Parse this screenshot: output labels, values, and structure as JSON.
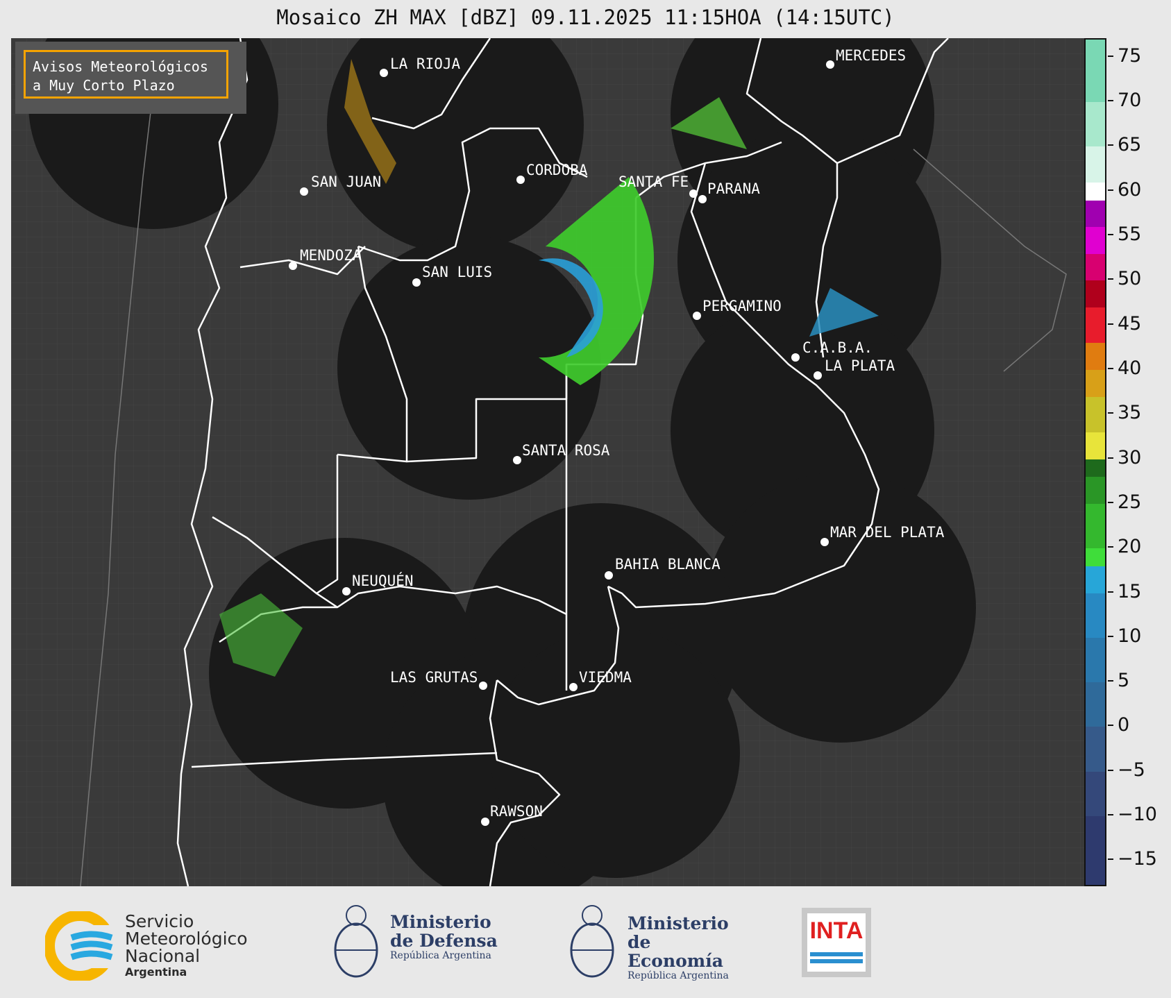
{
  "title": "Mosaico ZH MAX [dBZ] 09.11.2025 11:15HOA (14:15UTC)",
  "notice": {
    "line1": "Avisos Meteorológicos",
    "line2": "a Muy Corto Plazo"
  },
  "cities": [
    {
      "name": "LA RIOJA"
    },
    {
      "name": "MERCEDES"
    },
    {
      "name": "CORDOBA"
    },
    {
      "name": "SAN JUAN"
    },
    {
      "name": "SANTA FE"
    },
    {
      "name": "PARANA"
    },
    {
      "name": "MENDOZA"
    },
    {
      "name": "SAN LUIS"
    },
    {
      "name": "PERGAMINO"
    },
    {
      "name": "C.A.B.A."
    },
    {
      "name": "LA PLATA"
    },
    {
      "name": "SANTA ROSA"
    },
    {
      "name": "MAR DEL PLATA"
    },
    {
      "name": "BAHIA BLANCA"
    },
    {
      "name": "NEUQUÉN"
    },
    {
      "name": "LAS GRUTAS"
    },
    {
      "name": "VIEDMA"
    },
    {
      "name": "RAWSON"
    }
  ],
  "colorbar": {
    "min": -18,
    "max": 77,
    "ticks": [
      "75",
      "70",
      "65",
      "60",
      "55",
      "50",
      "45",
      "40",
      "35",
      "30",
      "25",
      "20",
      "15",
      "10",
      "5",
      "0",
      "−5",
      "−10",
      "−15"
    ],
    "tick_values": [
      75,
      70,
      65,
      60,
      55,
      50,
      45,
      40,
      35,
      30,
      25,
      20,
      15,
      10,
      5,
      0,
      -5,
      -10,
      -15
    ]
  },
  "logos": {
    "smn": {
      "line1": "Servicio",
      "line2": "Meteorológico",
      "line3": "Nacional",
      "line4": "Argentina"
    },
    "defensa": {
      "line1": "Ministerio",
      "line2": "de Defensa",
      "line3": "República Argentina"
    },
    "economia": {
      "line1": "Ministerio",
      "line2": "de Economía",
      "line3": "República Argentina"
    },
    "inta": {
      "text": "INTA"
    }
  },
  "colors": {
    "frame_bg": "#3a3a3a",
    "coverage": "#1a1a1a",
    "boundary": "#ffffff",
    "notice_border": "#f5a300"
  }
}
